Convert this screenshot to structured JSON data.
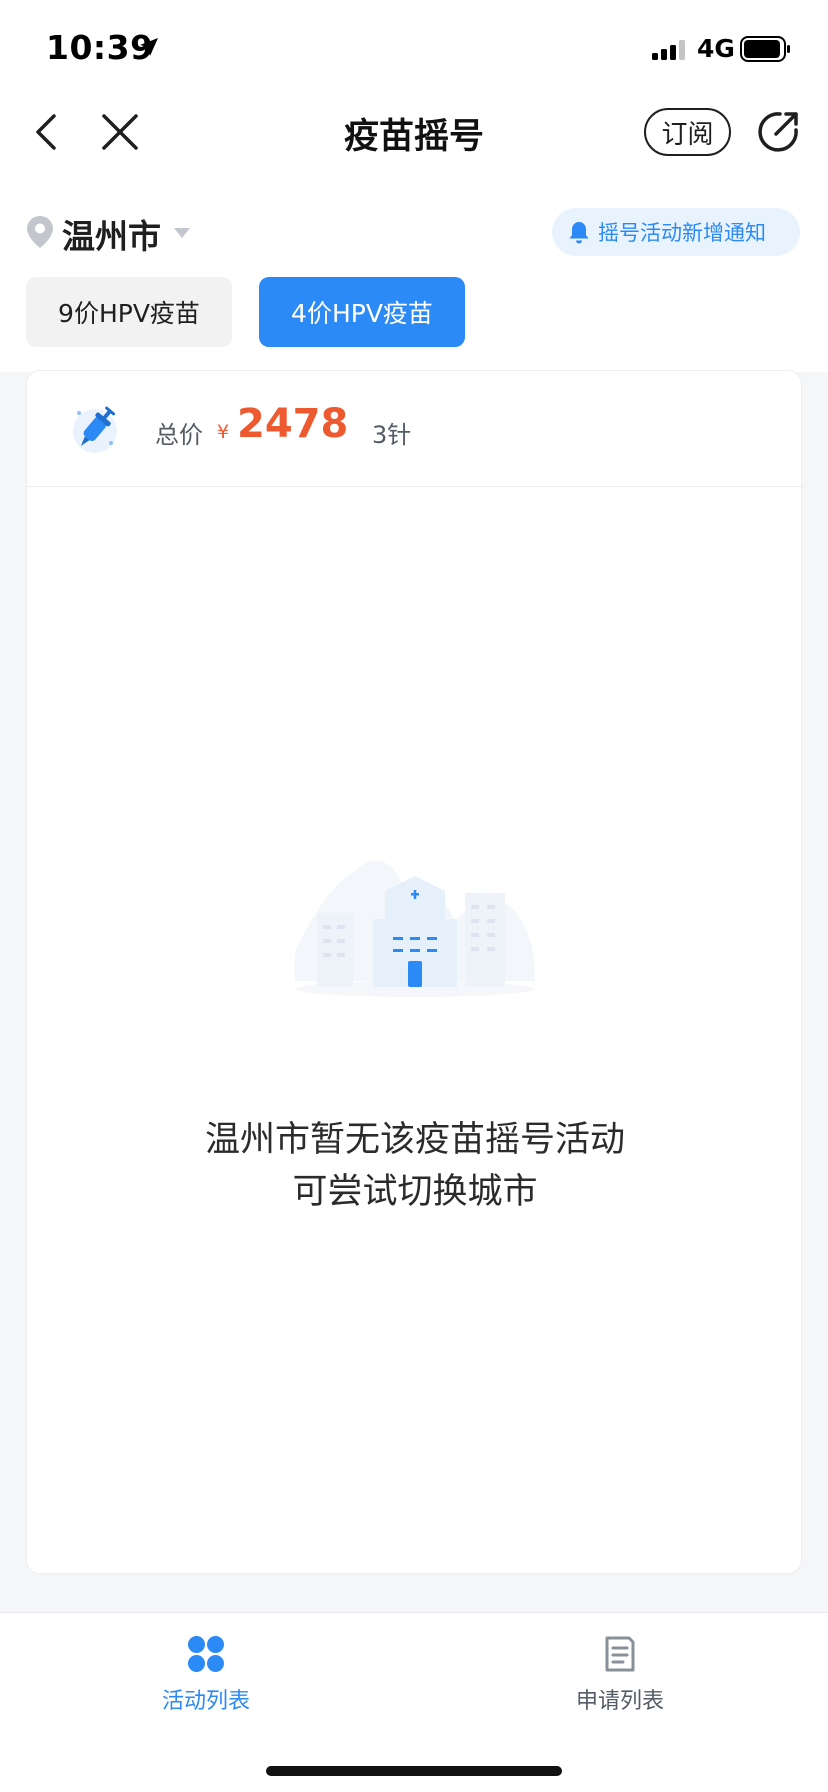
{
  "status_bar": {
    "time": "10:39",
    "network": "4G"
  },
  "nav": {
    "title": "疫苗摇号",
    "subscribe_label": "订阅"
  },
  "location": {
    "city": "温州市",
    "notify_label": "摇号活动新增通知"
  },
  "vaccine_tabs": [
    {
      "label": "9价HPV疫苗",
      "selected": false
    },
    {
      "label": "4价HPV疫苗",
      "selected": true
    }
  ],
  "price_row": {
    "label": "总价",
    "currency": "¥",
    "price": "2478",
    "doses": "3针"
  },
  "empty_state": {
    "line1": "温州市暂无该疫苗摇号活动",
    "line2": "可尝试切换城市"
  },
  "tabbar": {
    "items": [
      {
        "label": "活动列表",
        "active": true,
        "icon": "grid-icon"
      },
      {
        "label": "申请列表",
        "active": false,
        "icon": "document-icon"
      }
    ]
  },
  "colors": {
    "accent": "#2b8af5",
    "price": "#ee5a2f",
    "notify_bg": "#e8f3fe"
  }
}
